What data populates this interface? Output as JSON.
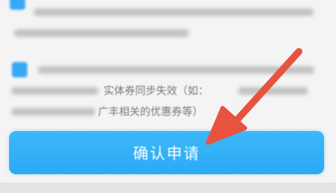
{
  "agreement": {
    "line_2_visible_text": "实体券同步失效（如：",
    "line_3_visible_text": "广丰相关的优惠券等）"
  },
  "confirm_button": {
    "label": "确认申请"
  },
  "colors": {
    "accent": "#2aa9f5",
    "arrow": "#e8533f"
  },
  "icons": {
    "checkbox": "checkbox-checked-icon",
    "annotation": "red-arrow-icon"
  }
}
